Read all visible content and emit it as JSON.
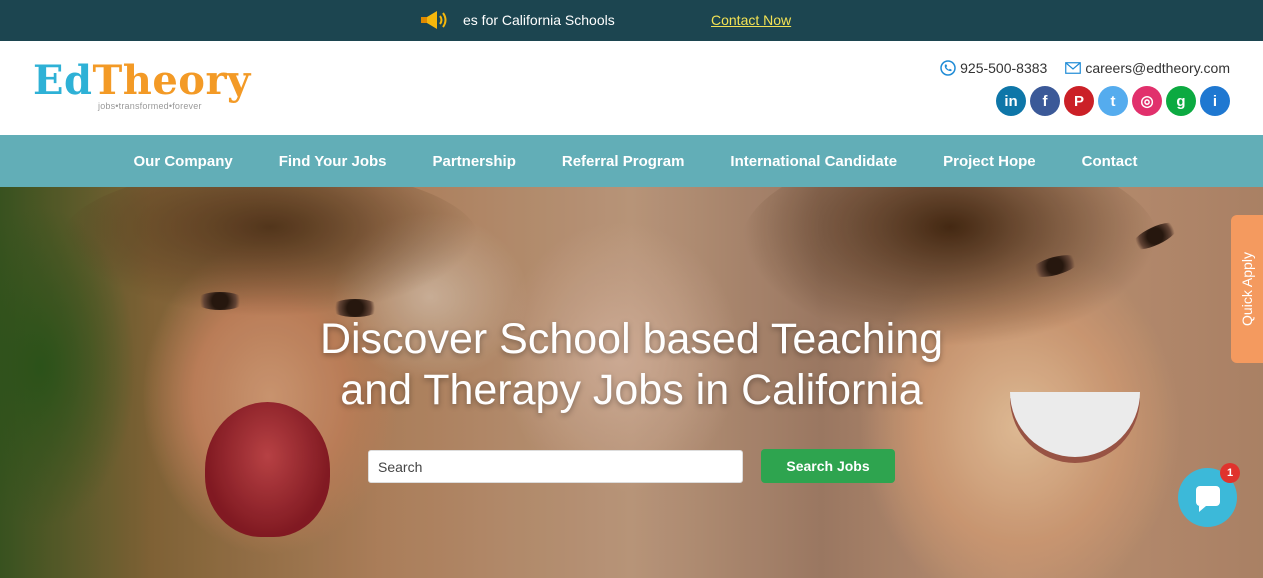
{
  "announcement": {
    "text": "es for California Schools",
    "cta": "Contact Now",
    "icon": "megaphone-icon"
  },
  "logo": {
    "part1": "Ed",
    "part2": "Theory",
    "tagline": "jobs•transformed•forever"
  },
  "contact": {
    "phone": "925-500-8383",
    "email": "careers@edtheory.com"
  },
  "social": [
    {
      "name": "linkedin-icon",
      "glyph": "in",
      "color": "#0e76a8"
    },
    {
      "name": "facebook-icon",
      "glyph": "f",
      "color": "#3b5998"
    },
    {
      "name": "pinterest-icon",
      "glyph": "P",
      "color": "#cb2027"
    },
    {
      "name": "twitter-icon",
      "glyph": "t",
      "color": "#55acee"
    },
    {
      "name": "instagram-icon",
      "glyph": "◎",
      "color": "#e1306c"
    },
    {
      "name": "glassdoor-icon",
      "glyph": "g",
      "color": "#0caa41"
    },
    {
      "name": "info-icon",
      "glyph": "i",
      "color": "#1f78d1"
    }
  ],
  "nav": {
    "items": [
      "Our Company",
      "Find Your Jobs",
      "Partnership",
      "Referral Program",
      "International Candidate",
      "Project Hope",
      "Contact"
    ]
  },
  "hero": {
    "headline_line1": "Discover School based Teaching",
    "headline_line2": "and Therapy Jobs in California",
    "search_placeholder": "Search",
    "search_button": "Search Jobs"
  },
  "quick_apply": "Quick Apply",
  "chat": {
    "badge": "1"
  }
}
